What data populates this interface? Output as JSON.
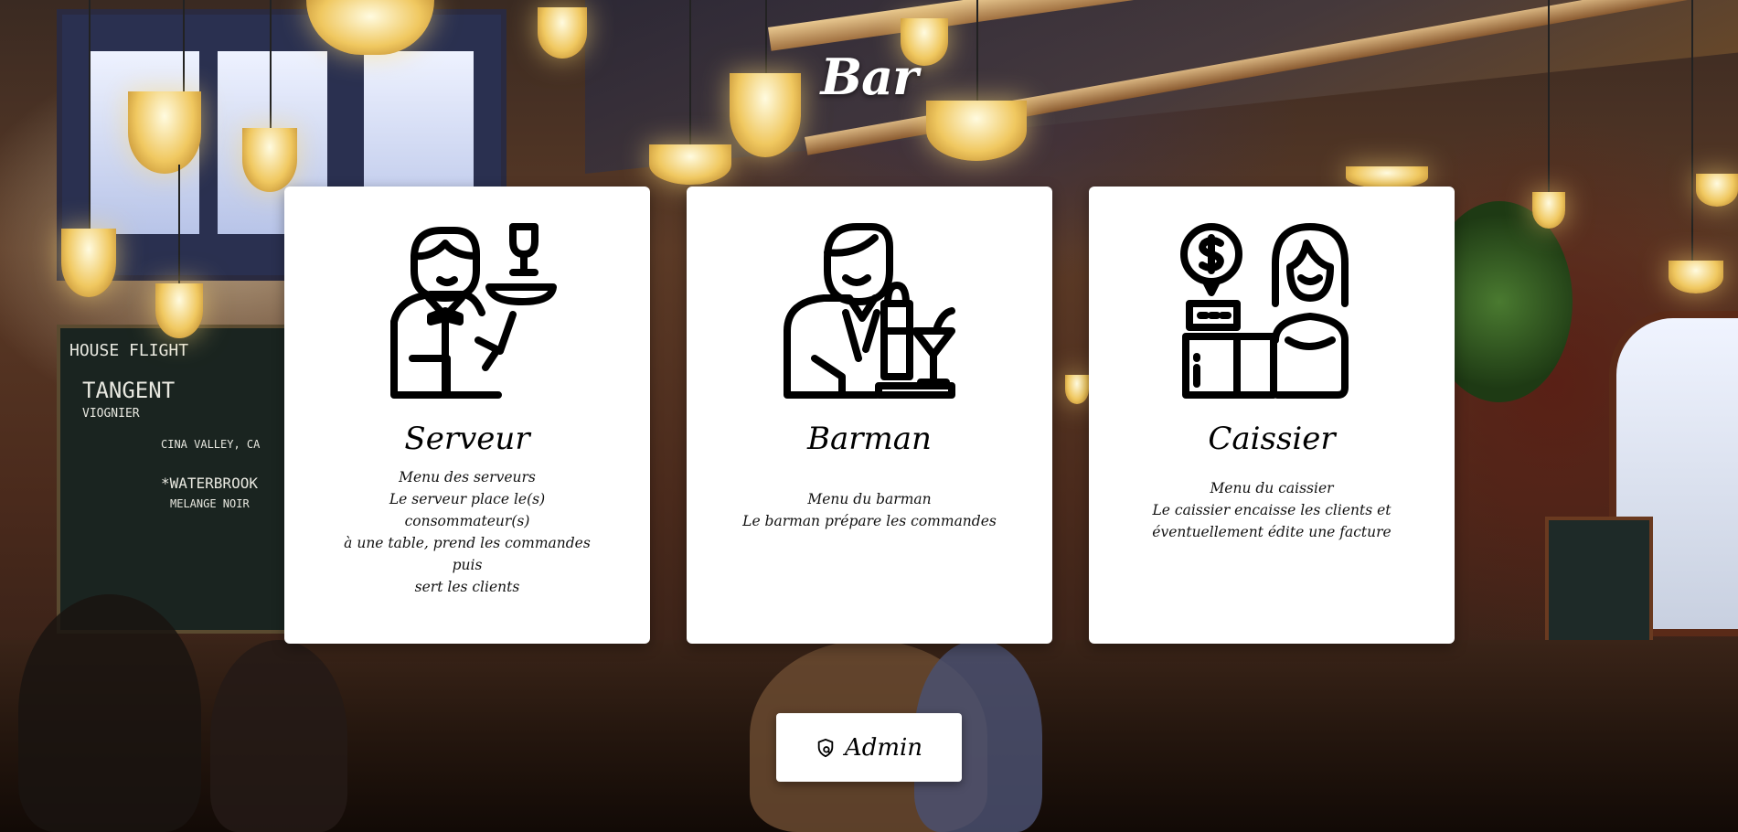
{
  "page": {
    "title": "Bar"
  },
  "cards": [
    {
      "name": "Serveur",
      "desc_lines": [
        "Menu des serveurs",
        "Le serveur place le(s) consommateur(s)",
        "à une table, prend les commandes puis",
        "sert les clients"
      ],
      "icon": "waiter-icon"
    },
    {
      "name": "Barman",
      "desc_lines": [
        "Menu du barman",
        "Le barman prépare les commandes"
      ],
      "icon": "bartender-icon"
    },
    {
      "name": "Caissier",
      "desc_lines": [
        "Menu du caissier",
        "Le caissier encaisse les clients et",
        "éventuellement édite une facture"
      ],
      "icon": "cashier-icon"
    }
  ],
  "admin": {
    "label": "Admin",
    "icon": "shield-icon"
  },
  "colors": {
    "card_bg": "#ffffff",
    "text": "#000000",
    "title": "#ffffff"
  }
}
